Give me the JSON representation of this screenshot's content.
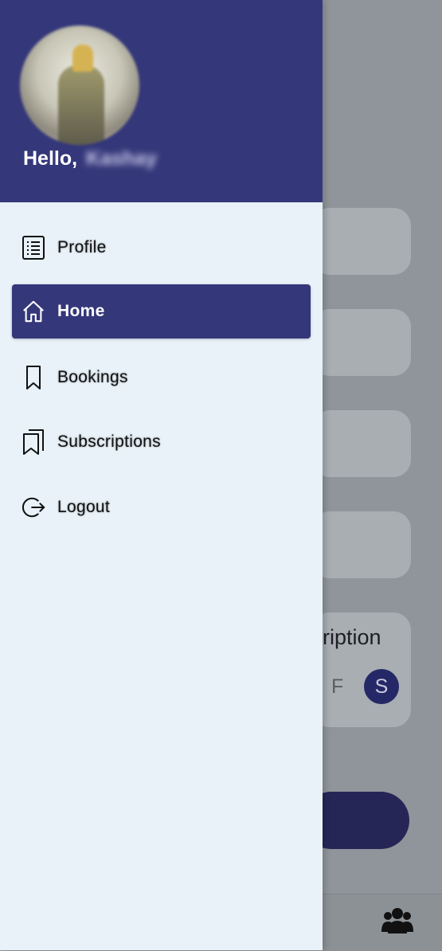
{
  "background": {
    "subscription_text": "ription",
    "day_f": "F",
    "day_s": "S",
    "users_icon": "users-icon"
  },
  "drawer": {
    "greeting": "Hello,",
    "user_name": "Kashay",
    "menu": [
      {
        "label": "Profile",
        "icon": "profile-list-icon",
        "active": false
      },
      {
        "label": "Home",
        "icon": "home-icon",
        "active": true
      },
      {
        "label": "Bookings",
        "icon": "bookmark-icon",
        "active": false
      },
      {
        "label": "Subscriptions",
        "icon": "bookmarks-icon",
        "active": false
      },
      {
        "label": "Logout",
        "icon": "logout-icon",
        "active": false
      }
    ]
  },
  "colors": {
    "primary": "#343779",
    "drawer_bg": "#e8f2f8",
    "scrim": "#8f959a"
  }
}
